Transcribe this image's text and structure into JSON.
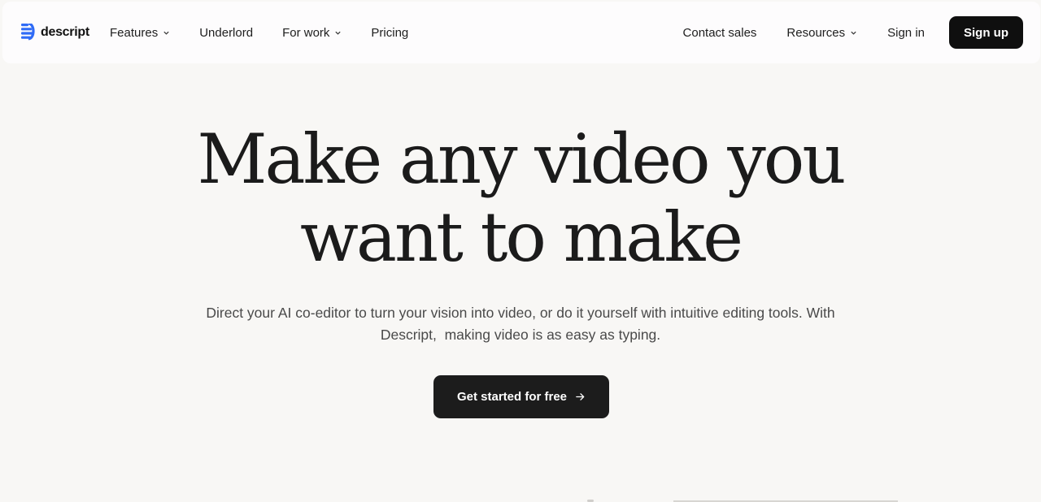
{
  "brand": {
    "name": "descript",
    "logo_icon": "descript-logo-icon",
    "accent": "#2f6bf6"
  },
  "nav": {
    "left": [
      {
        "label": "Features",
        "has_dropdown": true
      },
      {
        "label": "Underlord",
        "has_dropdown": false
      },
      {
        "label": "For work",
        "has_dropdown": true
      },
      {
        "label": "Pricing",
        "has_dropdown": false
      }
    ],
    "right": [
      {
        "label": "Contact sales",
        "has_dropdown": false
      },
      {
        "label": "Resources",
        "has_dropdown": true
      },
      {
        "label": "Sign in",
        "has_dropdown": false
      }
    ],
    "signup_label": "Sign up"
  },
  "hero": {
    "title_line1": "Make any video you",
    "title_line2": "want to make",
    "subtitle_line1": "Direct your AI co-editor to turn your vision into video, or do it yourself with intuitive editing tools. With",
    "subtitle_line2": "Descript,  making video is as easy as typing.",
    "cta_label": "Get started for free",
    "cta_icon": "arrow-right-icon"
  },
  "colors": {
    "page_bg": "#f8f7f5",
    "nav_bg": "#fdfcfd",
    "button_dark": "#0f0f0f",
    "text": "#1a1a1a"
  }
}
